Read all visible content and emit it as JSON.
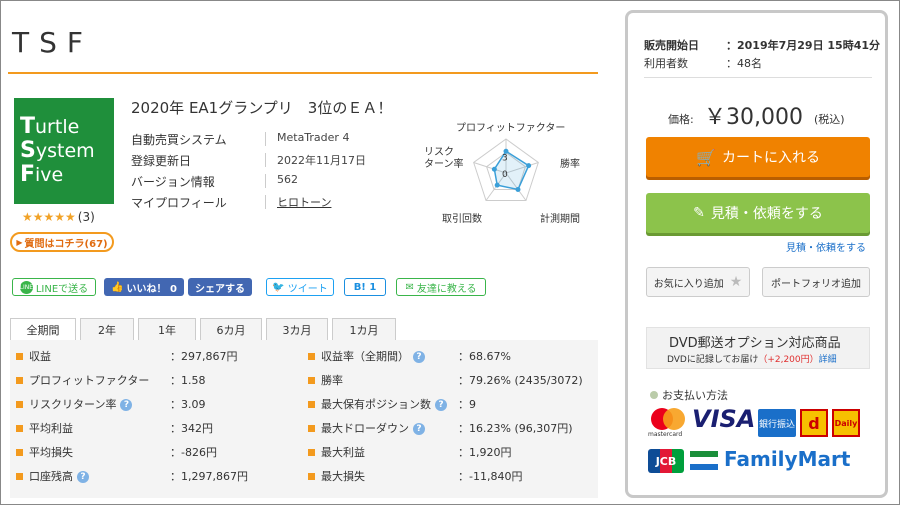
{
  "product": {
    "title": "TSF",
    "subtitle": "2020年 EA1グランプリ　3位のＥＡ！",
    "logo_lines": [
      {
        "cap": "T",
        "rest": "urtle"
      },
      {
        "cap": "S",
        "rest": "ystem"
      },
      {
        "cap": "F",
        "rest": "ive"
      }
    ],
    "stars": "★★★★★",
    "review_count": "(3)",
    "question_button": "質問はコチラ(67)"
  },
  "info": [
    {
      "key": "自動売買システム",
      "value": "MetaTrader 4",
      "link": false
    },
    {
      "key": "登録更新日",
      "value": "2022年11月17日",
      "link": false
    },
    {
      "key": "バージョン情報",
      "value": "562",
      "link": false
    },
    {
      "key": "マイプロフィール",
      "value": "ヒロトーン",
      "link": true
    }
  ],
  "radar": {
    "labels": [
      "プロフィットファクター",
      "勝率",
      "計測期間",
      "取引回数",
      "リスク\nターン率"
    ],
    "scale_labels": [
      "3",
      "0"
    ],
    "values": [
      3.2,
      3.5,
      3.0,
      2.2,
      1.8
    ],
    "max": 5,
    "color": "#3a9fd8"
  },
  "social": {
    "line": "LINEで送る",
    "fb_like": "いいね！ 0",
    "fb_share": "シェアする",
    "tweet": "ツイート",
    "hatena": "B! 1",
    "mail": "友達に教える"
  },
  "tabs": [
    "全期間",
    "2年",
    "1年",
    "6カ月",
    "3カ月",
    "1カ月"
  ],
  "stats_left": [
    {
      "label": "収益",
      "value": "：297,867円",
      "help": false
    },
    {
      "label": "プロフィットファクター",
      "value": "：1.58",
      "help": false
    },
    {
      "label": "リスクリターン率",
      "value": "：3.09",
      "help": true
    },
    {
      "label": "平均利益",
      "value": "：342円",
      "help": false
    },
    {
      "label": "平均損失",
      "value": "：-826円",
      "help": false
    },
    {
      "label": "口座残高",
      "value": "：1,297,867円",
      "help": true
    }
  ],
  "stats_right": [
    {
      "label": "収益率（全期間）",
      "value": "：68.67%",
      "help": true
    },
    {
      "label": "勝率",
      "value": "：79.26% (2435/3072)",
      "help": false
    },
    {
      "label": "最大保有ポジション数",
      "value": "：9",
      "help": true
    },
    {
      "label": "最大ドローダウン",
      "value": "：16.23% (96,307円)",
      "help": true
    },
    {
      "label": "最大利益",
      "value": "：1,920円",
      "help": false
    },
    {
      "label": "最大損失",
      "value": "：-11,840円",
      "help": false
    }
  ],
  "sidebar": {
    "release_label": "販売開始日",
    "release_value": "：2019年7月29日 15時41分",
    "users_label": "利用者数",
    "users_value": "：48名",
    "price_label": "価格:",
    "price_value": "￥30,000",
    "price_tax": "(税込)",
    "cart_button": "カートに入れる",
    "quote_button": "見積・依頼をする",
    "quote_link": "見積・依頼をする",
    "favorite_button": "お気に入り追加",
    "portfolio_button": "ポートフォリオ追加",
    "dvd_title": "DVD郵送オプション対応商品",
    "dvd_desc": "DVDに記録してお届け",
    "dvd_price": "（+2,200円）",
    "dvd_detail": "詳細",
    "payment_title": "お支払い方法",
    "payment_methods": [
      "mastercard",
      "VISA",
      "銀行振込",
      "d",
      "Daily",
      "JCB",
      "FamilyMart"
    ]
  },
  "colors": {
    "accent": "#f39a1e",
    "cart": "#f08200",
    "quote": "#8cc34b",
    "link": "#1a6fc9",
    "dvd_price": "#e03030"
  }
}
